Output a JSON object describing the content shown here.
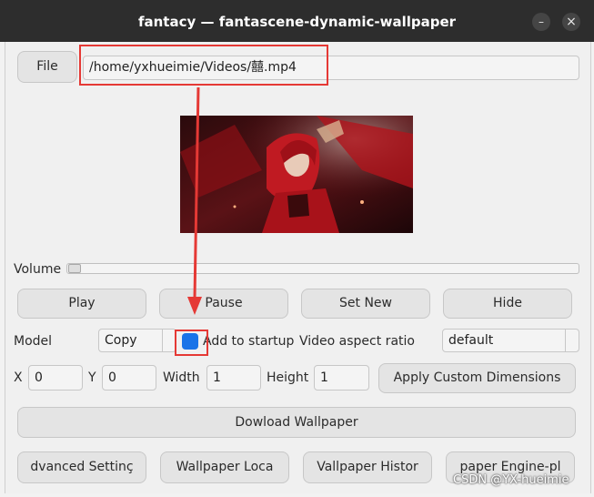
{
  "window": {
    "title": "fantacy — fantascene-dynamic-wallpaper",
    "minimize_glyph": "–",
    "close_glyph": "×"
  },
  "file": {
    "button_label": "File",
    "path": "/home/yxhueimie/Videos/囍.mp4"
  },
  "volume": {
    "label": "Volume",
    "level": 0
  },
  "controls": {
    "play": "Play",
    "pause": "Pause",
    "set_new": "Set New",
    "hide": "Hide"
  },
  "model": {
    "label": "Model",
    "value": "Copy",
    "startup_label": "Add to startup",
    "startup_checked": true,
    "aspect_label": "Video aspect ratio",
    "aspect_value": "default"
  },
  "dimensions": {
    "x_label": "X",
    "x_value": "0",
    "y_label": "Y",
    "y_value": "0",
    "width_label": "Width",
    "width_value": "1",
    "height_label": "Height",
    "height_value": "1",
    "apply_label": "Apply Custom Dimensions"
  },
  "download_label": "Dowload Wallpaper",
  "bottom_buttons": [
    "dvanced Settinç",
    "Wallpaper Loca",
    "Vallpaper Histor",
    "paper Engine-pl"
  ],
  "watermark": "CSDN @YX-hueimie",
  "colors": {
    "accent_blue": "#1a73e8",
    "annotation_red": "#e53935",
    "titlebar": "#2d2d2d"
  }
}
